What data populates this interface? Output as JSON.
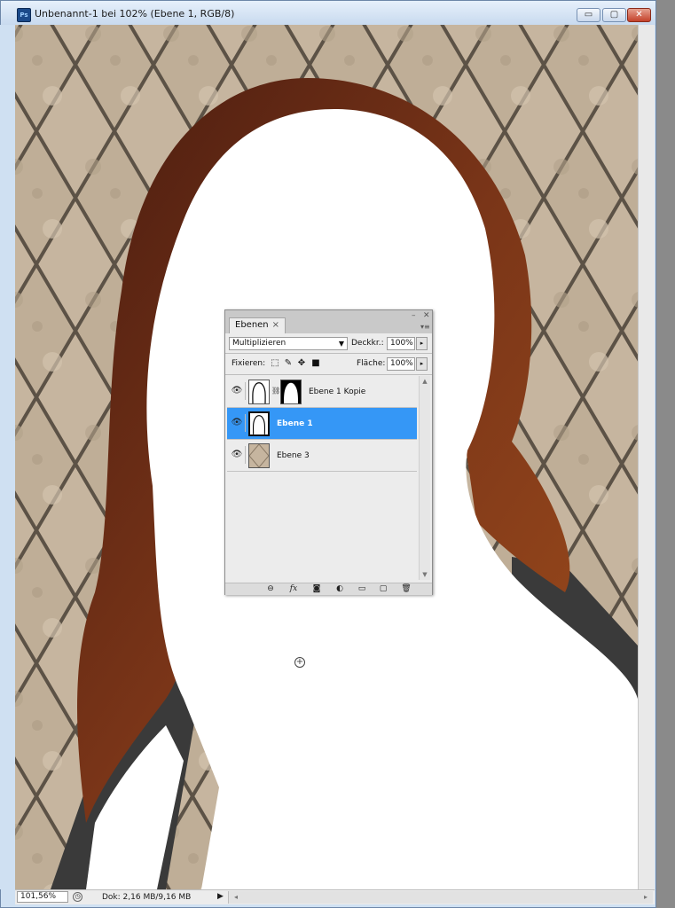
{
  "window": {
    "app_icon": "photoshop-icon",
    "title": "Unbenannt-1 bei 102% (Ebene 1, RGB/8)",
    "min_glyph": "▭",
    "max_glyph": "▢",
    "close_glyph": "✕"
  },
  "layers_panel": {
    "tab_label": "Ebenen",
    "tab_close": "×",
    "blend_mode": "Multiplizieren",
    "opacity_label": "Deckkr.:",
    "opacity_value": "100%",
    "lock_label": "Fixieren:",
    "fill_label": "Fläche:",
    "fill_value": "100%",
    "layers": [
      {
        "name": "Ebene 1 Kopie",
        "selected": false,
        "has_mask": true
      },
      {
        "name": "Ebene 1",
        "selected": true,
        "has_mask": false
      },
      {
        "name": "Ebene 3",
        "selected": false,
        "has_mask": false
      }
    ]
  },
  "status_bar": {
    "zoom": "101,56%",
    "doc_info": "Dok: 2,16 MB/9,16 MB"
  },
  "colors": {
    "selection": "#3597f6",
    "hair": "#6b2f17",
    "tile": "#c8b8a2",
    "grout": "#5c5246",
    "shirt": "#3a3a3a"
  }
}
